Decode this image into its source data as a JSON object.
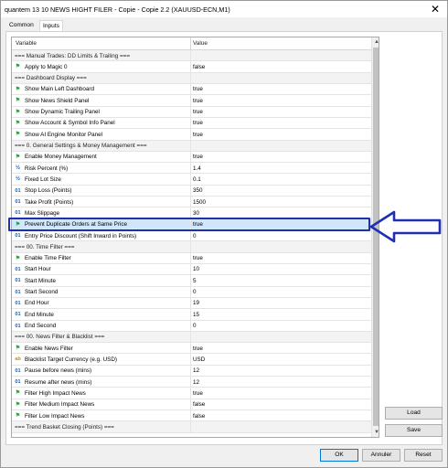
{
  "window": {
    "title": "quantem 13 10 NEWS HIGHT FILER - Copie - Copie 2.2 (XAUUSD-ECN,M1)",
    "close_glyph": "✕"
  },
  "tabs": [
    {
      "label": "Common",
      "active": false
    },
    {
      "label": "Inputs",
      "active": true
    }
  ],
  "table": {
    "headers": {
      "variable": "Variable",
      "value": "Value"
    },
    "rows": [
      {
        "type": "section",
        "label": "=== Manual Trades: DD Limits & Trailing ===",
        "value": ""
      },
      {
        "type": "flag",
        "icon": "flag-icon",
        "label": "Apply to Magic 0",
        "value": "false"
      },
      {
        "type": "section",
        "label": "=== Dashboard Display ===",
        "value": ""
      },
      {
        "type": "flag",
        "icon": "flag-icon",
        "label": "Show Main Left Dashboard",
        "value": "true"
      },
      {
        "type": "flag",
        "icon": "flag-icon",
        "label": "Show News Shield Panel",
        "value": "true"
      },
      {
        "type": "flag",
        "icon": "flag-icon",
        "label": "Show Dynamic Trailing Panel",
        "value": "true"
      },
      {
        "type": "flag",
        "icon": "flag-icon",
        "label": "Show Account & Symbol Info Panel",
        "value": "true"
      },
      {
        "type": "flag",
        "icon": "flag-icon",
        "label": "Show AI Engine Monitor Panel",
        "value": "true"
      },
      {
        "type": "section",
        "label": "=== 0. General Settings & Money Management ===",
        "value": ""
      },
      {
        "type": "flag",
        "icon": "flag-icon",
        "label": "Enable Money Management",
        "value": "true"
      },
      {
        "type": "dbl",
        "icon": "double-icon",
        "label": "Risk Percent (%)",
        "value": "1.4"
      },
      {
        "type": "dbl",
        "icon": "double-icon",
        "label": "Fixed Lot Size",
        "value": "0.1"
      },
      {
        "type": "int",
        "icon": "integer-icon",
        "label": "Stop Loss (Points)",
        "value": "350"
      },
      {
        "type": "int",
        "icon": "integer-icon",
        "label": "Take Profit (Points)",
        "value": "1500"
      },
      {
        "type": "int",
        "icon": "integer-icon",
        "label": "Max Slippage",
        "value": "30"
      },
      {
        "type": "flag",
        "icon": "flag-icon",
        "label": "Prevent Duplicate Orders at Same Price",
        "value": "true",
        "selected": true
      },
      {
        "type": "int",
        "icon": "integer-icon",
        "label": "Entry Price Discount (Shift Inward in Points)",
        "value": "0"
      },
      {
        "type": "section",
        "label": "=== 00. Time Filter ===",
        "value": ""
      },
      {
        "type": "flag",
        "icon": "flag-icon",
        "label": "Enable Time Filter",
        "value": "true"
      },
      {
        "type": "int",
        "icon": "integer-icon",
        "label": "Start Hour",
        "value": "10"
      },
      {
        "type": "int",
        "icon": "integer-icon",
        "label": "Start Minute",
        "value": "5"
      },
      {
        "type": "int",
        "icon": "integer-icon",
        "label": "Start Second",
        "value": "0"
      },
      {
        "type": "int",
        "icon": "integer-icon",
        "label": "End Hour",
        "value": "19"
      },
      {
        "type": "int",
        "icon": "integer-icon",
        "label": "End Minute",
        "value": "15"
      },
      {
        "type": "int",
        "icon": "integer-icon",
        "label": "End Second",
        "value": "0"
      },
      {
        "type": "section",
        "label": "=== 00. News Filter & Blacklist ===",
        "value": ""
      },
      {
        "type": "flag",
        "icon": "flag-icon",
        "label": "Enable News Filter",
        "value": "true"
      },
      {
        "type": "str",
        "icon": "string-icon",
        "label": "Blacklist Target Currency (e.g. USD)",
        "value": "USD"
      },
      {
        "type": "int",
        "icon": "integer-icon",
        "label": "Pause before news (mins)",
        "value": "12"
      },
      {
        "type": "int",
        "icon": "integer-icon",
        "label": "Resume after news (mins)",
        "value": "12"
      },
      {
        "type": "flag",
        "icon": "flag-icon",
        "label": "Filter High Impact News",
        "value": "true"
      },
      {
        "type": "flag",
        "icon": "flag-icon",
        "label": "Filter Medium Impact News",
        "value": "false"
      },
      {
        "type": "flag",
        "icon": "flag-icon",
        "label": "Filter Low Impact News",
        "value": "false"
      },
      {
        "type": "section",
        "label": "=== Trend Basket Closing (Points) ===",
        "value": ""
      }
    ]
  },
  "icon_glyphs": {
    "flag": "⚑",
    "int": "01",
    "dbl": "½",
    "str": "ab"
  },
  "side_buttons": {
    "load": "Load",
    "save": "Save"
  },
  "footer": {
    "ok": "OK",
    "cancel": "Annuler",
    "reset": "Reset"
  },
  "annotation": {
    "color": "#1f2fb0"
  }
}
